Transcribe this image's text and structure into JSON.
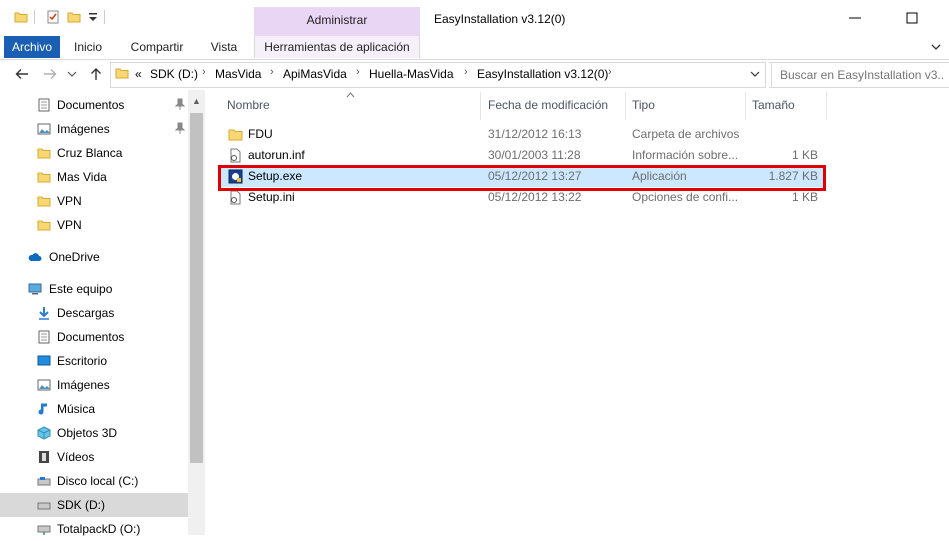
{
  "window": {
    "title": "EasyInstallation v3.12(0)",
    "context_group": "Administrar"
  },
  "ribbon": {
    "tabs": [
      "Archivo",
      "Inicio",
      "Compartir",
      "Vista",
      "Herramientas de aplicación"
    ]
  },
  "address": {
    "prefix": "«",
    "crumbs": [
      "SDK (D:)",
      "MasVida",
      "ApiMasVida",
      "Huella-MasVida",
      "EasyInstallation v3.12(0)"
    ],
    "search_placeholder": "Buscar en EasyInstallation v3...."
  },
  "nav": {
    "quick": [
      "Documentos",
      "Imágenes",
      "Cruz Blanca",
      "Mas Vida",
      "VPN",
      "VPN"
    ],
    "onedrive": "OneDrive",
    "pc": "Este equipo",
    "pc_items": [
      "Descargas",
      "Documentos",
      "Escritorio",
      "Imágenes",
      "Música",
      "Objetos 3D",
      "Vídeos",
      "Disco local (C:)",
      "SDK (D:)",
      "TotalpackD (O:)"
    ]
  },
  "columns": {
    "name": "Nombre",
    "date": "Fecha de modificación",
    "type": "Tipo",
    "size": "Tamaño"
  },
  "files": [
    {
      "name": "FDU",
      "date": "31/12/2012 16:13",
      "type": "Carpeta de archivos",
      "size": "",
      "icon": "folder-icon"
    },
    {
      "name": "autorun.inf",
      "date": "30/01/2003 11:28",
      "type": "Información sobre...",
      "size": "1 KB",
      "icon": "settings-file-icon"
    },
    {
      "name": "Setup.exe",
      "date": "05/12/2012 13:27",
      "type": "Aplicación",
      "size": "1.827 KB",
      "icon": "app-exe-icon"
    },
    {
      "name": "Setup.ini",
      "date": "05/12/2012 13:22",
      "type": "Opciones de confi...",
      "size": "1 KB",
      "icon": "settings-file-icon"
    }
  ],
  "colors": {
    "accent": "#1a5fb4",
    "selection": "#cce8ff",
    "highlight_box": "#e00000",
    "context_tab": "#e9d6f5"
  }
}
